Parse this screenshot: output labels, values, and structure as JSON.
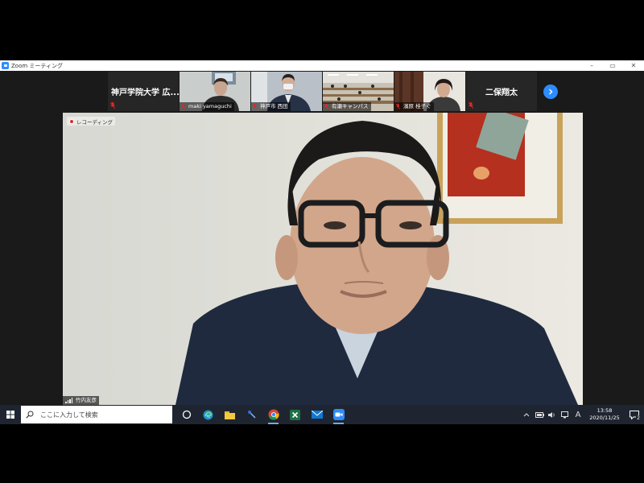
{
  "window": {
    "title": "Zoom ミーティング",
    "controls": {
      "minimize": "–",
      "maximize": "▭",
      "close": "✕"
    }
  },
  "gallery": {
    "tiles": [
      {
        "name": "神戸学院大学 広...",
        "type": "name-only"
      },
      {
        "name": "maki yamaguchi",
        "type": "video"
      },
      {
        "name": "神戸市 西田",
        "type": "video"
      },
      {
        "name": "有瀬キャンパス",
        "type": "video"
      },
      {
        "name": "濱原 桂子ぐ",
        "type": "video"
      },
      {
        "name": "二保翔太",
        "type": "name-only"
      }
    ]
  },
  "main_video": {
    "recording_label": "レコーディング",
    "speaker_name": "竹内友彦"
  },
  "taskbar": {
    "search_placeholder": "ここに入力して検索",
    "ime_indicator": "A",
    "time": "13:58",
    "date": "2020/11/25",
    "notification_count": "2"
  },
  "colors": {
    "zoom_blue": "#2d8cff",
    "muted_red": "#e02828",
    "taskbar_bg": "#1f2530",
    "gallery_bg": "#1a1a1a"
  }
}
